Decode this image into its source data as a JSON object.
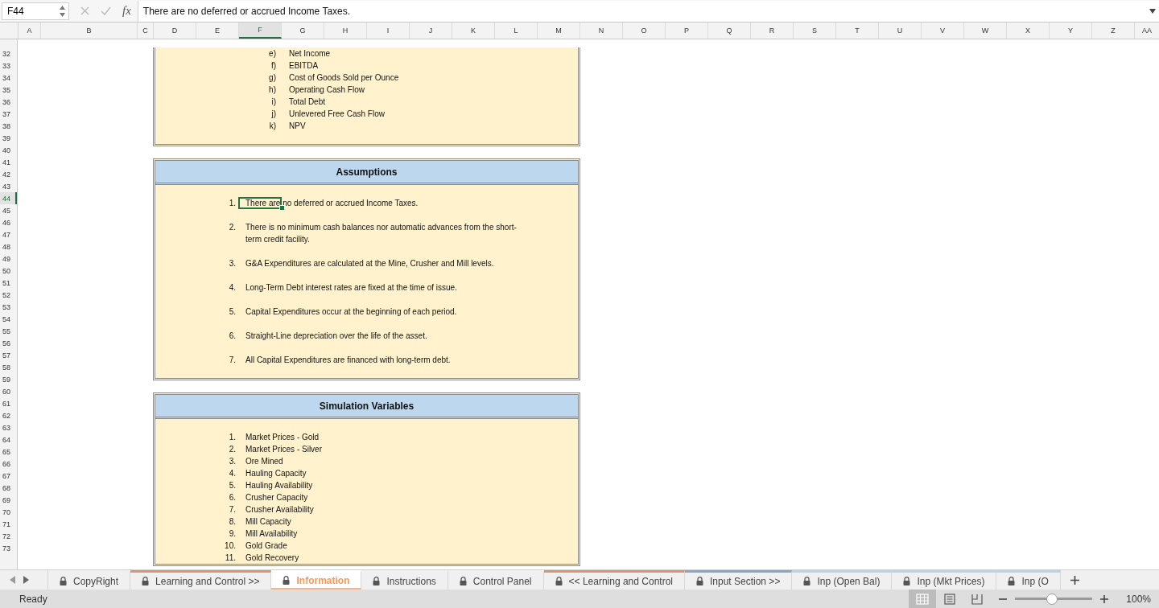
{
  "formula_bar": {
    "name_box": "F44",
    "fx_label": "fx",
    "formula": "There are no deferred or accrued Income Taxes."
  },
  "columns": [
    {
      "label": "A",
      "selected": false
    },
    {
      "label": "B",
      "selected": false
    },
    {
      "label": "C",
      "selected": false
    },
    {
      "label": "D",
      "selected": false
    },
    {
      "label": "E",
      "selected": false
    },
    {
      "label": "F",
      "selected": true
    },
    {
      "label": "G",
      "selected": false
    },
    {
      "label": "H",
      "selected": false
    },
    {
      "label": "I",
      "selected": false
    },
    {
      "label": "J",
      "selected": false
    },
    {
      "label": "K",
      "selected": false
    },
    {
      "label": "L",
      "selected": false
    },
    {
      "label": "M",
      "selected": false
    },
    {
      "label": "N",
      "selected": false
    },
    {
      "label": "O",
      "selected": false
    },
    {
      "label": "P",
      "selected": false
    },
    {
      "label": "Q",
      "selected": false
    },
    {
      "label": "R",
      "selected": false
    },
    {
      "label": "S",
      "selected": false
    },
    {
      "label": "T",
      "selected": false
    },
    {
      "label": "U",
      "selected": false
    },
    {
      "label": "V",
      "selected": false
    },
    {
      "label": "W",
      "selected": false
    },
    {
      "label": "X",
      "selected": false
    },
    {
      "label": "Y",
      "selected": false
    },
    {
      "label": "Z",
      "selected": false
    },
    {
      "label": "AA",
      "selected": false
    }
  ],
  "rows": [
    {
      "number": "32",
      "selected": false
    },
    {
      "number": "33",
      "selected": false
    },
    {
      "number": "34",
      "selected": false
    },
    {
      "number": "35",
      "selected": false
    },
    {
      "number": "36",
      "selected": false
    },
    {
      "number": "37",
      "selected": false
    },
    {
      "number": "38",
      "selected": false
    },
    {
      "number": "39",
      "selected": false
    },
    {
      "number": "40",
      "selected": false
    },
    {
      "number": "41",
      "selected": false
    },
    {
      "number": "42",
      "selected": false
    },
    {
      "number": "43",
      "selected": false
    },
    {
      "number": "44",
      "selected": true
    },
    {
      "number": "45",
      "selected": false
    },
    {
      "number": "46",
      "selected": false
    },
    {
      "number": "47",
      "selected": false
    },
    {
      "number": "48",
      "selected": false
    },
    {
      "number": "49",
      "selected": false
    },
    {
      "number": "50",
      "selected": false
    },
    {
      "number": "51",
      "selected": false
    },
    {
      "number": "52",
      "selected": false
    },
    {
      "number": "53",
      "selected": false
    },
    {
      "number": "54",
      "selected": false
    },
    {
      "number": "55",
      "selected": false
    },
    {
      "number": "56",
      "selected": false
    },
    {
      "number": "57",
      "selected": false
    },
    {
      "number": "58",
      "selected": false
    },
    {
      "number": "59",
      "selected": false
    },
    {
      "number": "60",
      "selected": false
    },
    {
      "number": "61",
      "selected": false
    },
    {
      "number": "62",
      "selected": false
    },
    {
      "number": "63",
      "selected": false
    },
    {
      "number": "64",
      "selected": false
    },
    {
      "number": "65",
      "selected": false
    },
    {
      "number": "66",
      "selected": false
    },
    {
      "number": "67",
      "selected": false
    },
    {
      "number": "68",
      "selected": false
    },
    {
      "number": "69",
      "selected": false
    },
    {
      "number": "70",
      "selected": false
    },
    {
      "number": "71",
      "selected": false
    },
    {
      "number": "72",
      "selected": false
    },
    {
      "number": "73",
      "selected": false
    }
  ],
  "outputs_list": [
    {
      "marker": "e)",
      "text": "Net Income"
    },
    {
      "marker": "f)",
      "text": "EBITDA"
    },
    {
      "marker": "g)",
      "text": "Cost of Goods Sold per Ounce"
    },
    {
      "marker": "h)",
      "text": "Operating Cash Flow"
    },
    {
      "marker": "i)",
      "text": "Total Debt"
    },
    {
      "marker": "j)",
      "text": "Unlevered Free Cash Flow"
    },
    {
      "marker": "k)",
      "text": "NPV"
    }
  ],
  "assumptions": {
    "title": "Assumptions",
    "items": [
      {
        "number": "1.",
        "text": "There are no deferred or accrued Income Taxes.",
        "selected": true
      },
      {
        "number": "2.",
        "text": "There is no minimum cash balances nor automatic advances from the short-term credit facility.",
        "selected": false
      },
      {
        "number": "3.",
        "text": "G&A Expenditures are calculated at the Mine, Crusher and Mill levels.",
        "selected": false
      },
      {
        "number": "4.",
        "text": "Long-Term Debt interest rates are fixed at the time of issue.",
        "selected": false
      },
      {
        "number": "5.",
        "text": "Capital Expenditures occur at the beginning of each period.",
        "selected": false
      },
      {
        "number": "6.",
        "text": "Straight-Line depreciation over the life of the asset.",
        "selected": false
      },
      {
        "number": "7.",
        "text": "All Capital Expenditures are financed with long-term debt.",
        "selected": false
      }
    ]
  },
  "simulation_variables": {
    "title": "Simulation Variables",
    "items": [
      {
        "number": "1.",
        "text": "Market Prices - Gold"
      },
      {
        "number": "2.",
        "text": "Market Prices - Silver"
      },
      {
        "number": "3.",
        "text": "Ore Mined"
      },
      {
        "number": "4.",
        "text": "Hauling Capacity"
      },
      {
        "number": "5.",
        "text": "Hauling Availability"
      },
      {
        "number": "6.",
        "text": "Crusher Capacity"
      },
      {
        "number": "7.",
        "text": "Crusher Availability"
      },
      {
        "number": "8.",
        "text": "Mill Capacity"
      },
      {
        "number": "9.",
        "text": "Mill Availability"
      },
      {
        "number": "10.",
        "text": "Gold Grade"
      },
      {
        "number": "11.",
        "text": "Gold Recovery"
      }
    ]
  },
  "sheet_tabs": [
    {
      "label": "CopyRight",
      "selected": false
    },
    {
      "label": "Learning and Control >>",
      "selected": false,
      "color": "#e0936a"
    },
    {
      "label": "Information",
      "selected": true
    },
    {
      "label": "Instructions",
      "selected": false
    },
    {
      "label": "Control Panel",
      "selected": false
    },
    {
      "label": "<< Learning and Control",
      "selected": false,
      "color": "#e0936a"
    },
    {
      "label": "Input Section >>",
      "selected": false,
      "color": "#7ea7d2"
    },
    {
      "label": "Inp (Open Bal)",
      "selected": false,
      "color": "#b7d3ee"
    },
    {
      "label": "Inp (Mkt Prices)",
      "selected": false,
      "color": "#b7d3ee"
    },
    {
      "label": "Inp (O",
      "selected": false,
      "color": "#b7d3ee"
    }
  ],
  "status_bar": {
    "status": "Ready",
    "views": [
      {
        "kind": "normal",
        "selected": true
      },
      {
        "kind": "page-layout",
        "selected": false
      },
      {
        "kind": "page-break",
        "selected": false
      }
    ],
    "zoom": {
      "level": 0.48,
      "reading": "100%"
    }
  }
}
